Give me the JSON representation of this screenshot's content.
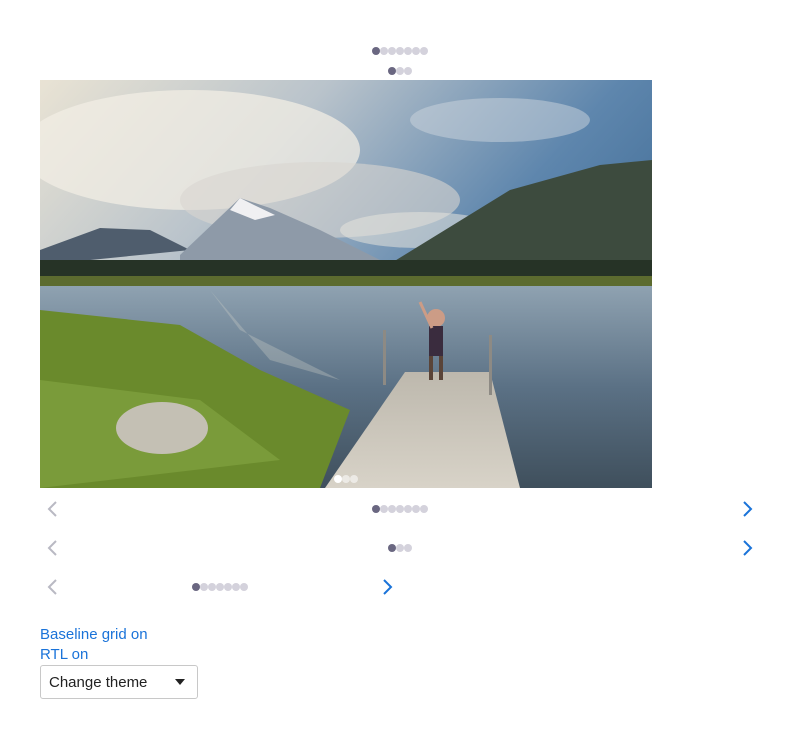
{
  "carousels": {
    "top_pagination": {
      "count": 7,
      "active": 1
    },
    "second_pagination": {
      "count": 3,
      "active": 1
    },
    "photo_carousel_dots": {
      "count": 3,
      "active": 1
    },
    "row1": {
      "count": 7,
      "active": 1,
      "prev_icon": "chevron-left-icon",
      "next_icon": "chevron-right-icon"
    },
    "row2": {
      "count": 3,
      "active": 1,
      "prev_icon": "chevron-left-icon",
      "next_icon": "chevron-right-icon"
    },
    "row3": {
      "count": 7,
      "active": 1,
      "prev_icon": "chevron-left-icon",
      "next_icon": "chevron-right-icon"
    }
  },
  "controls": {
    "baseline_grid_label": "Baseline grid on",
    "rtl_label": "RTL on",
    "theme_select_value": "Change theme",
    "theme_select_icon": "caret-down-icon"
  },
  "colors": {
    "accent": "#1a73d9",
    "dot_active": "#6a6781",
    "dot_inactive": "#d4d2dc",
    "arrow_disabled": "#b9b9c3"
  }
}
